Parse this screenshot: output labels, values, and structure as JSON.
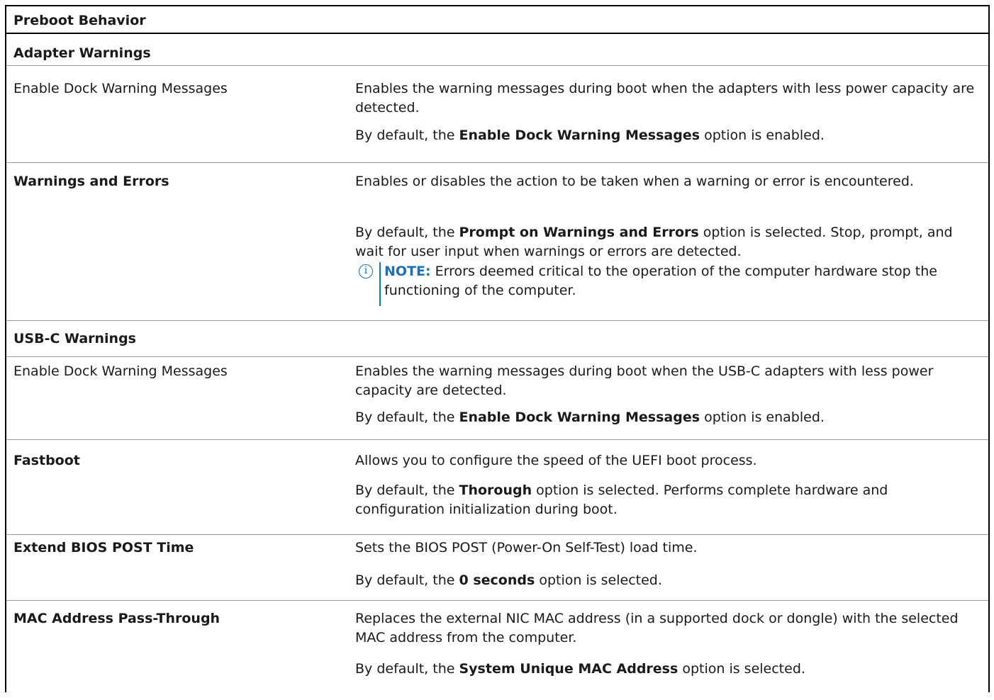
{
  "table": {
    "header": "Preboot Behavior",
    "sections": [
      {
        "title": "Adapter Warnings",
        "rows": [
          {
            "name": "Enable Dock Warning Messages",
            "bold": false,
            "desc": "Enables the warning messages during boot when the adapters with less power capacity are detected.",
            "default_pre": "By default, the ",
            "default_bold": "Enable Dock Warning Messages",
            "default_post": " option is enabled."
          },
          {
            "name": "Warnings and Errors",
            "bold": true,
            "desc": "Enables or disables the action to be taken when a warning or error is encountered.",
            "default_pre": "By default, the ",
            "default_bold": "Prompt on Warnings and Errors",
            "default_post": " option is selected. Stop, prompt, and wait for user input when warnings or errors are detected.",
            "note_label": "NOTE:",
            "note_text": " Errors deemed critical to the operation of the computer hardware stop the functioning of the computer."
          }
        ]
      },
      {
        "title": "USB-C Warnings",
        "rows": [
          {
            "name": "Enable Dock Warning Messages",
            "bold": false,
            "desc": "Enables the warning messages during boot when the USB-C adapters with less power capacity are detected.",
            "default_pre": "By default, the ",
            "default_bold": "Enable Dock Warning Messages",
            "default_post": " option is enabled."
          },
          {
            "name": "Fastboot",
            "bold": true,
            "desc": "Allows you to configure the speed of the UEFI boot process.",
            "default_pre": "By default, the ",
            "default_bold": "Thorough",
            "default_post": " option is selected. Performs complete hardware and configuration initialization during boot."
          },
          {
            "name": "Extend BIOS POST Time",
            "bold": true,
            "desc": "Sets the BIOS POST (Power-On Self-Test) load time.",
            "default_pre": "By default, the ",
            "default_bold": "0 seconds",
            "default_post": " option is selected."
          },
          {
            "name": "MAC Address Pass-Through",
            "bold": true,
            "desc": "Replaces the external NIC MAC address (in a supported dock or dongle) with the selected MAC address from the computer.",
            "default_pre": "By default, the ",
            "default_bold": "System Unique MAC Address",
            "default_post": " option is selected."
          }
        ]
      }
    ]
  },
  "colors": {
    "note_accent": "#1a6fb5",
    "border": "#000000",
    "divider": "#9a9a9a"
  },
  "icons": {
    "note": "info-circle-icon",
    "note_glyph": "i"
  }
}
